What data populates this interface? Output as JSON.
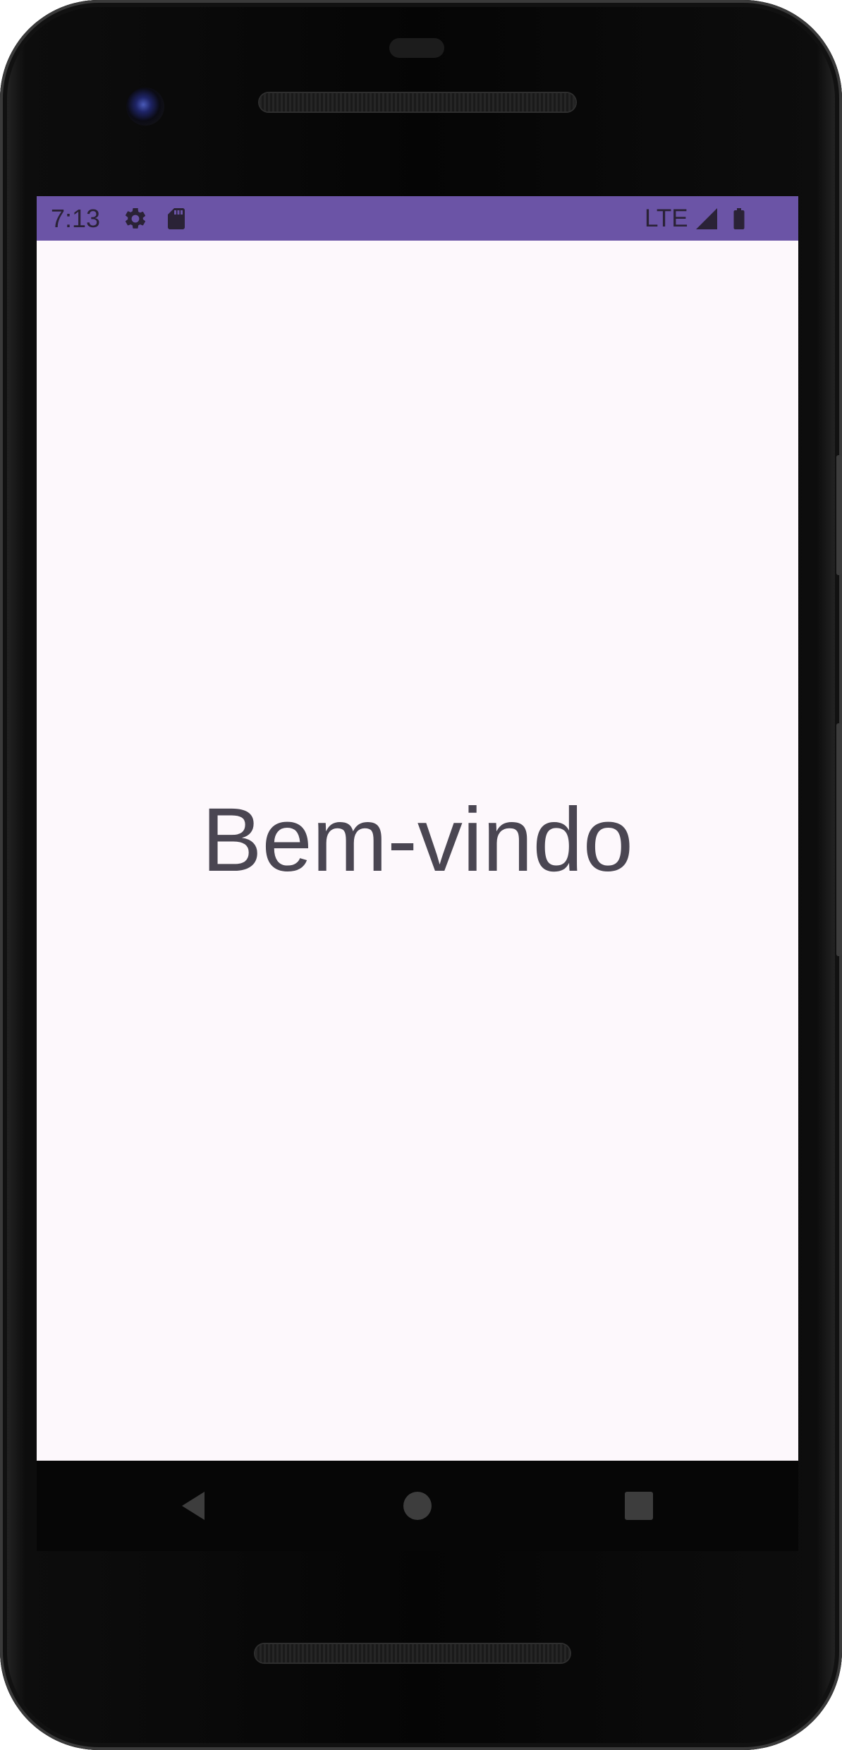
{
  "status_bar": {
    "time": "7:13",
    "network": "LTE",
    "background_color": "#6b54a6",
    "icons": [
      "settings-icon",
      "sd-card-icon",
      "signal-icon",
      "battery-icon"
    ]
  },
  "main": {
    "welcome_text": "Bem-vindo",
    "background_color": "#fdf8fc",
    "text_color": "#4a4652"
  },
  "nav_bar": {
    "buttons": [
      "back-icon",
      "home-icon",
      "recents-icon"
    ]
  }
}
